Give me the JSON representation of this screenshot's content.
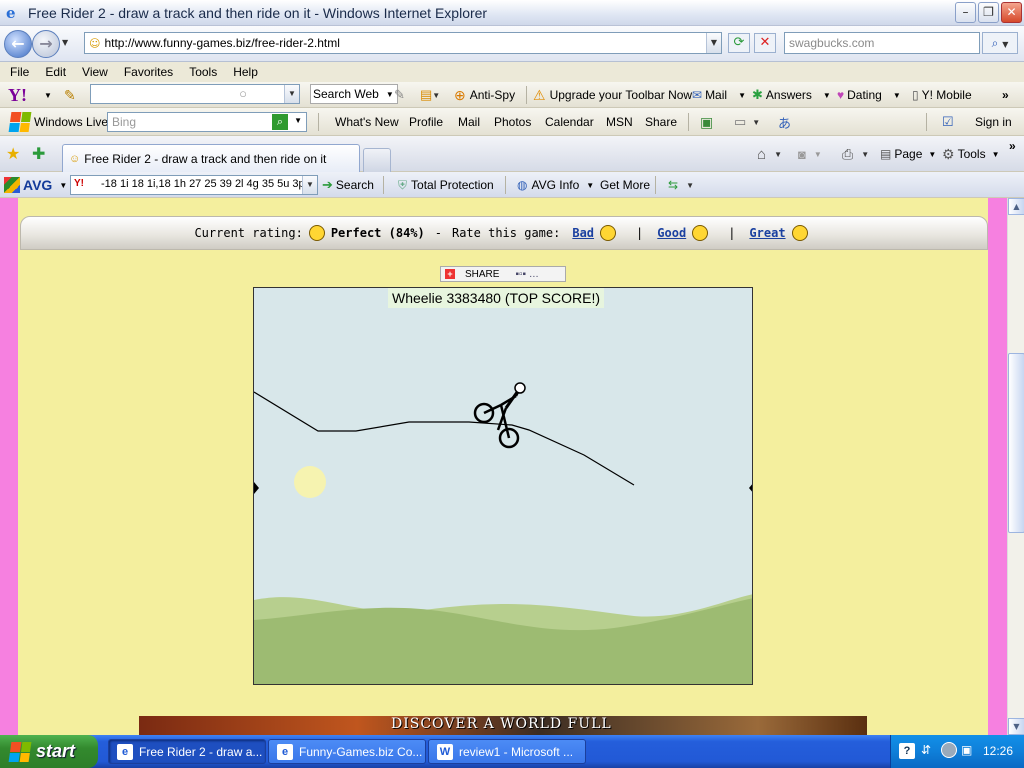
{
  "window": {
    "title": "Free Rider 2 - draw a track and then ride on it - Windows Internet Explorer",
    "minimize": "–",
    "maximize": "❐",
    "close": "✕"
  },
  "address": {
    "url": "http://www.funny-games.biz/free-rider-2.html",
    "search_placeholder": "swagbucks.com"
  },
  "menu": [
    "File",
    "Edit",
    "View",
    "Favorites",
    "Tools",
    "Help"
  ],
  "yahoo_toolbar": {
    "logo": "Y!",
    "search_web": "Search Web",
    "anti_spy": "Anti-Spy",
    "upgrade": "Upgrade your Toolbar Now",
    "mail": "Mail",
    "answers": "Answers",
    "dating": "Dating",
    "mobile": "Y! Mobile"
  },
  "live_toolbar": {
    "brand": "Windows Live",
    "search_placeholder": "Bing",
    "links": [
      "What's New",
      "Profile",
      "Mail",
      "Photos",
      "Calendar",
      "MSN",
      "Share"
    ],
    "sign_in": "Sign in"
  },
  "tabs": {
    "active_tab": "Free Rider 2 - draw a track and then ride on it",
    "page_menu": "Page",
    "tools_menu": "Tools"
  },
  "avg_toolbar": {
    "brand": "AVG",
    "search_text": "-18 1i 18 1i,18 1h 27 25 39 2l 4g 35 5u 3p",
    "search_button": "Search",
    "total_protection": "Total Protection",
    "avg_info": "AVG Info",
    "get_more": "Get More"
  },
  "rating": {
    "label": "Current rating:",
    "value": "Perfect (84%)",
    "dash": "-",
    "rate_label": "Rate this game:",
    "bad": "Bad",
    "good": "Good",
    "great": "Great",
    "sep": "|"
  },
  "share": {
    "label": "SHARE"
  },
  "game": {
    "score_text": "Wheelie 3383480 (TOP SCORE!)",
    "colors": {
      "sky": "#d8e7ea",
      "hill_light": "#b7cf8e",
      "hill_dark": "#9dbb72",
      "sun": "#f6f3b0"
    }
  },
  "banner": {
    "text": "DISCOVER A WORLD FULL"
  },
  "taskbar": {
    "start": "start",
    "tasks": [
      "Free Rider 2 - draw a...",
      "Funny-Games.biz Co...",
      "review1 - Microsoft ..."
    ],
    "clock": "12:26"
  }
}
